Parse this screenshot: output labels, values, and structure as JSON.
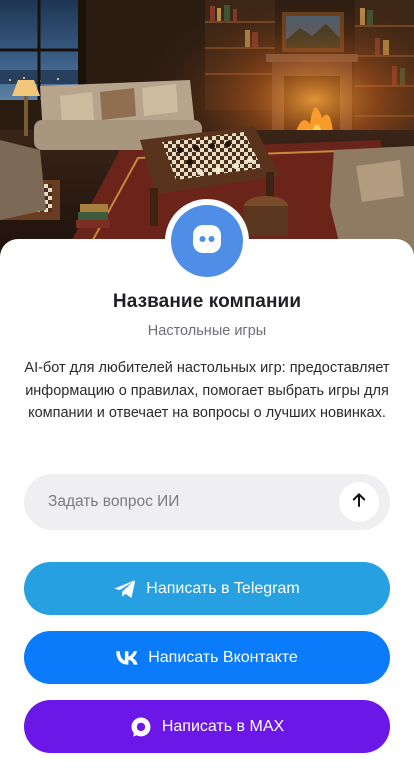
{
  "hero": {
    "icon": "library-chess-scene-image"
  },
  "profile": {
    "avatar_icon": "chat-bot-icon",
    "name": "Название компании",
    "category": "Настольные игры",
    "description": "AI-бот для любителей настольных игр: предоставляет информацию о правилах, помогает выбрать игры для компании и отвечает на вопросы о лучших новинках."
  },
  "ask": {
    "placeholder": "Задать вопрос ИИ",
    "value": "",
    "send_icon": "arrow-up-icon"
  },
  "buttons": {
    "telegram": {
      "label": "Написать в Telegram",
      "icon": "telegram-icon",
      "color": "#26a0e0"
    },
    "vk": {
      "label": "Написать Вконтакте",
      "icon": "vk-icon",
      "color": "#0a7bfa"
    },
    "max": {
      "label": "Написать в MAX",
      "icon": "max-icon",
      "color": "#6b17e8"
    }
  },
  "colors": {
    "accent_avatar": "#4f8ee6",
    "text_primary": "#1f1f24",
    "text_secondary": "#6e6e74",
    "input_bg": "#efeff1"
  }
}
